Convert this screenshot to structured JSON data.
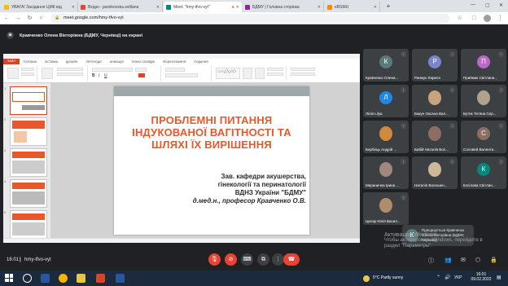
{
  "browser": {
    "tabs": [
      {
        "label": "УВАГА! Засідання ЦМК від",
        "color": "#fbbc04",
        "active": false
      },
      {
        "label": "Вхідні - jasnikovska.svitlana",
        "color": "#ea4335",
        "active": false
      },
      {
        "label": "Meet: \"hmy-tfvo-vyt\"",
        "color": "#00897b",
        "active": true
      },
      {
        "label": "БДМУ | Головна сторінка",
        "color": "#8e24aa",
        "active": false
      },
      {
        "label": "eBSMU",
        "color": "#fb8c00",
        "active": false
      }
    ],
    "new_tab": "+",
    "url": "meet.google.com/hmy-tfvo-vyt"
  },
  "meet": {
    "presenting_label": "Кравченко Олена Вікторівна (БДМУ, Чернівці) на екрані",
    "time": "16:01",
    "meeting_code": "hmy-tfvo-vyt"
  },
  "ppt": {
    "file_tab": "ФАЙЛ",
    "tabs": [
      "ГОЛОВНА",
      "ВСТАВКА",
      "ДИЗАЙН",
      "ПЕРЕХОДИ",
      "АНІМАЦІЯ",
      "ПОКАЗ СЛАЙДІВ",
      "РЕЦЕНЗУВАННЯ",
      "ПОДАННЯ"
    ],
    "thumb_numbers": [
      "1",
      "2",
      "3",
      "4",
      "5"
    ],
    "slide_title": "ПРОБЛЕМНІ ПИТАННЯ ІНДУКОВАНОЇ ВАГІТНОСТІ ТА ШЛЯХІ ЇХ ВИРІШЕННЯ",
    "slide_sub1": "Зав. кафедри акушерства,",
    "slide_sub2": "гінекології та перинатології",
    "slide_sub3": "ВДНЗ України \"БДМУ\"",
    "slide_sub4": "д.мед.н., професор Кравченко О.В."
  },
  "participants": [
    {
      "name": "Кравченко Олена...",
      "initial": "К",
      "color": "#5b7a7a",
      "photo": false
    },
    {
      "name": "Ринжук Лариса",
      "initial": "Р",
      "color": "#7986cb",
      "photo": false
    },
    {
      "name": "Приймак Світлана...",
      "initial": "П",
      "color": "#ba68c8",
      "photo": false
    },
    {
      "name": "Лілія Lilya",
      "initial": "Л",
      "color": "#1e88e5",
      "photo": false
    },
    {
      "name": "Бакун Оксана Вал...",
      "initial": "",
      "color": "#c9a27e",
      "photo": true
    },
    {
      "name": "Бутяк Тетяна Сер...",
      "initial": "",
      "color": "#b0a18a",
      "photo": true
    },
    {
      "name": "Бербець Андрій ...",
      "initial": "",
      "color": "#d08a3c",
      "photo": true
    },
    {
      "name": "Бабій Наталія Вол...",
      "initial": "",
      "color": "#8d6e63",
      "photo": true
    },
    {
      "name": "Соловей Валенти...",
      "initial": "С",
      "color": "#8d6e63",
      "photo": false
    },
    {
      "name": "Меринична Ірина ...",
      "initial": "",
      "color": "#a1887f",
      "photo": true
    },
    {
      "name": "Наталія Волошен...",
      "initial": "",
      "color": "#cfb79a",
      "photo": true
    },
    {
      "name": "Косілова Світлан...",
      "initial": "К",
      "color": "#00897b",
      "photo": false
    },
    {
      "name": "Цисар Юлія Васил...",
      "initial": "",
      "color": "#b08d6a",
      "photo": true
    }
  ],
  "notification": {
    "text": "Приєднується Кравченко Олена Вікторівна (БДМУ, Чернівці)",
    "avatar": "К"
  },
  "windows_watermark": {
    "line1": "Активация Windows",
    "line2": "Чтобы активировать Windows, перейдите в",
    "line3": "раздел \"Параметры\"."
  },
  "taskbar": {
    "weather": "5°C  Partly sunny",
    "lang": "УКР",
    "time": "16:01",
    "date": "09.02.2022"
  }
}
